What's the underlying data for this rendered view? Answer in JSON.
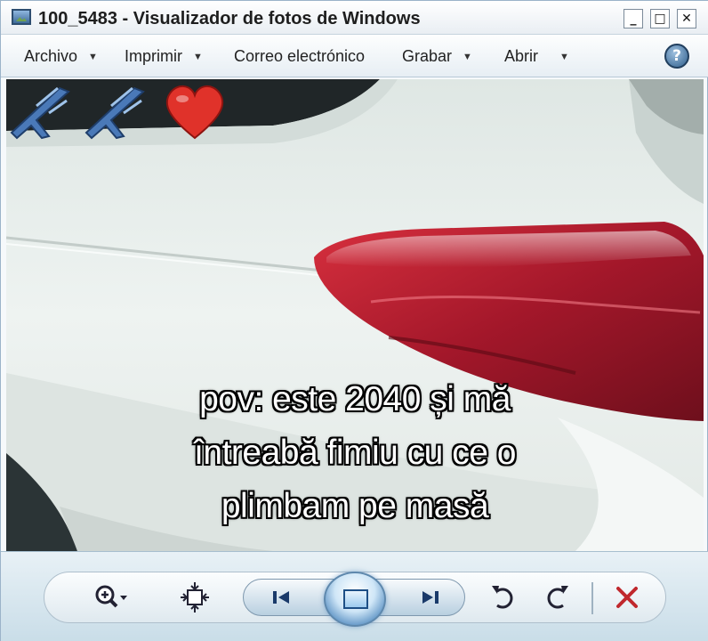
{
  "window": {
    "title": "100_5483 - Visualizador de fotos de Windows",
    "controls": {
      "minimize": "_",
      "maximize": "□",
      "close": "✕"
    }
  },
  "menu": {
    "items": [
      {
        "label": "Archivo",
        "has_dropdown": true
      },
      {
        "label": "Imprimir",
        "has_dropdown": true
      },
      {
        "label": "Correo electrónico",
        "has_dropdown": false
      },
      {
        "label": "Grabar",
        "has_dropdown": true
      },
      {
        "label": "Abrir",
        "has_dropdown": true
      }
    ],
    "help_glyph": "?"
  },
  "photo": {
    "caption_lines": [
      "pov: este 2040 și mă",
      "întreabă fimiu cu ce o",
      "plimbam pe masă"
    ],
    "emojis": [
      "airplane",
      "airplane",
      "red-heart"
    ],
    "colors": {
      "car_body": "#e9efec",
      "tail_light": "#b3202e",
      "caption_text": "#ffffff"
    }
  },
  "toolbar": {
    "zoom_icon": "zoom-icon",
    "fit_icon": "actual-size-icon",
    "prev_icon": "previous-icon",
    "slideshow_icon": "slideshow-icon",
    "next_icon": "next-icon",
    "rotate_ccw_icon": "rotate-counterclockwise-icon",
    "rotate_cw_icon": "rotate-clockwise-icon",
    "delete_icon": "delete-icon",
    "accent": "#3a79b5",
    "delete_color": "#c0282d"
  }
}
